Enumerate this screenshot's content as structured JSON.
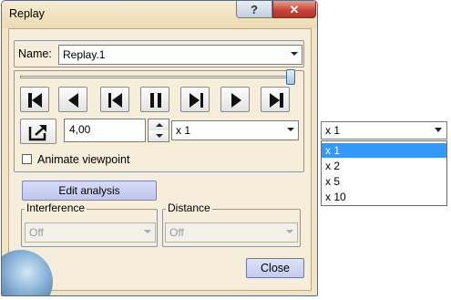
{
  "window": {
    "title": "Replay",
    "help_label": "?",
    "close_label": "✕"
  },
  "name_field": {
    "label": "Name:",
    "value": "Replay.1"
  },
  "player_buttons": [
    {
      "name": "jump-to-start",
      "icon": "skip-to-start-icon"
    },
    {
      "name": "step-backward",
      "icon": "step-back-icon"
    },
    {
      "name": "previous",
      "icon": "previous-icon"
    },
    {
      "name": "pause",
      "icon": "pause-icon"
    },
    {
      "name": "next",
      "icon": "next-icon"
    },
    {
      "name": "play",
      "icon": "play-icon"
    },
    {
      "name": "jump-to-end",
      "icon": "skip-to-end-icon"
    }
  ],
  "step": {
    "value": "4,00",
    "speed_value": "x 1"
  },
  "animate_viewpoint": {
    "label": "Animate viewpoint",
    "checked": false
  },
  "edit_analysis_label": "Edit analysis",
  "interference": {
    "label": "Interference",
    "value": "Off"
  },
  "distance": {
    "label": "Distance",
    "value": "Off"
  },
  "close_button_label": "Close",
  "speed_dropdown": {
    "current": "x 1",
    "options": [
      "x 1",
      "x 2",
      "x 5",
      "x 10"
    ],
    "selected_index": 0
  },
  "colors": {
    "dialog_bg": "#f3e4c3",
    "selection": "#3399ff",
    "close_button": "#c7463a"
  }
}
